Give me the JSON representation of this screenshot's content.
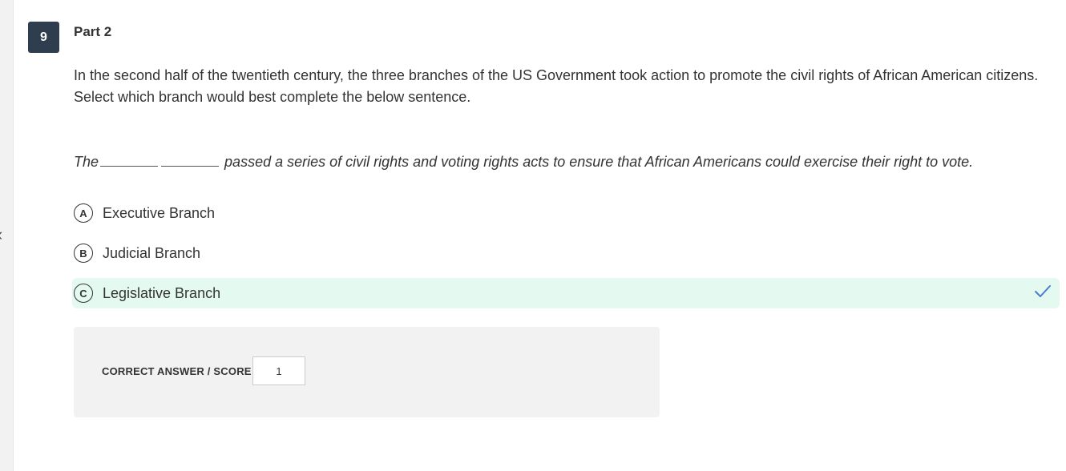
{
  "question": {
    "number": "9",
    "part_title": "Part 2",
    "prompt_line1": "In the second half of the twentieth century, the three branches of the US Government took action to promote the civil rights of African American citizens.",
    "prompt_line2": "Select which branch would best complete the below sentence.",
    "sentence_start": "The",
    "sentence_end": "passed a series of civil rights and voting rights acts to ensure that African Americans could exercise their right to vote."
  },
  "options": [
    {
      "letter": "A",
      "label": "Executive Branch",
      "correct": false
    },
    {
      "letter": "B",
      "label": "Judicial Branch",
      "correct": false
    },
    {
      "letter": "C",
      "label": "Legislative Branch",
      "correct": true
    }
  ],
  "score_panel": {
    "label": "CORRECT ANSWER / SCORE",
    "value": "1"
  },
  "icons": {
    "collapse": "chevron-left-icon",
    "correct": "check-icon"
  },
  "colors": {
    "question_badge": "#2f3e4e",
    "correct_highlight": "#e4faf1",
    "check": "#4a7bd0"
  }
}
